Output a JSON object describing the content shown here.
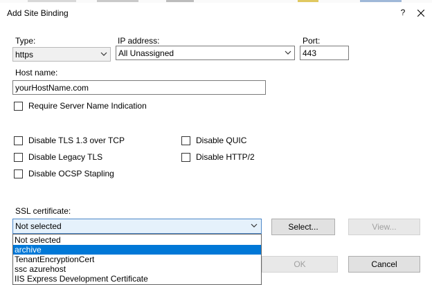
{
  "dialog": {
    "title": "Add Site Binding",
    "help_label": "?"
  },
  "type_field": {
    "label": "Type:",
    "value": "https"
  },
  "ip_field": {
    "label": "IP address:",
    "value": "All Unassigned"
  },
  "port_field": {
    "label": "Port:",
    "value": "443"
  },
  "host_field": {
    "label": "Host name:",
    "value": "yourHostName.com"
  },
  "checkboxes": {
    "sni": {
      "label": "Require Server Name Indication",
      "checked": false
    },
    "disable_tls13": {
      "label": "Disable TLS 1.3 over TCP",
      "checked": false
    },
    "disable_quic": {
      "label": "Disable QUIC",
      "checked": false
    },
    "disable_legacy_tls": {
      "label": "Disable Legacy TLS",
      "checked": false
    },
    "disable_http2": {
      "label": "Disable HTTP/2",
      "checked": false
    },
    "disable_ocsp": {
      "label": "Disable OCSP Stapling",
      "checked": false
    }
  },
  "ssl": {
    "label": "SSL certificate:",
    "value": "Not selected",
    "select_button": "Select...",
    "view_button": "View...",
    "options": [
      {
        "label": "Not selected",
        "highlighted": false
      },
      {
        "label": "archive",
        "highlighted": true
      },
      {
        "label": "TenantEncryptionCert",
        "highlighted": false
      },
      {
        "label": "ssc azurehost",
        "highlighted": false
      },
      {
        "label": "IIS Express Development Certificate",
        "highlighted": false
      }
    ]
  },
  "footer": {
    "ok_button": "OK",
    "cancel_button": "Cancel"
  },
  "colors": {
    "selection": "#0078d7",
    "focus_border": "#4c87c8",
    "focus_fill": "#e5f1fb",
    "disabled_text": "#a0a0a0"
  }
}
